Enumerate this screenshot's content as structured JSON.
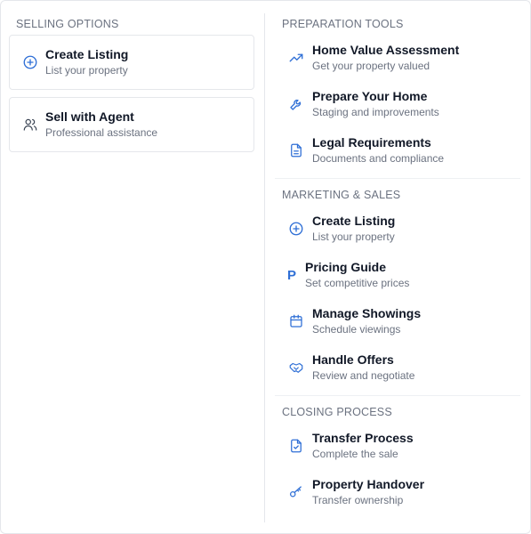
{
  "selling_options": {
    "header": "SELLING OPTIONS",
    "items": [
      {
        "title": "Create Listing",
        "subtitle": "List your property",
        "icon": "plus-circle-icon"
      },
      {
        "title": "Sell with Agent",
        "subtitle": "Professional assistance",
        "icon": "users-icon"
      }
    ]
  },
  "sections": [
    {
      "header": "PREPARATION TOOLS",
      "items": [
        {
          "title": "Home Value Assessment",
          "subtitle": "Get your property valued",
          "icon": "trending-up-icon"
        },
        {
          "title": "Prepare Your Home",
          "subtitle": "Staging and improvements",
          "icon": "wrench-icon"
        },
        {
          "title": "Legal Requirements",
          "subtitle": "Documents and compliance",
          "icon": "document-icon"
        }
      ]
    },
    {
      "header": "MARKETING & SALES",
      "items": [
        {
          "title": "Create Listing",
          "subtitle": "List your property",
          "icon": "plus-circle-icon"
        },
        {
          "title": "Pricing Guide",
          "subtitle": "Set competitive prices",
          "icon": "p-letter-icon",
          "glyph": "P"
        },
        {
          "title": "Manage Showings",
          "subtitle": "Schedule viewings",
          "icon": "calendar-icon"
        },
        {
          "title": "Handle Offers",
          "subtitle": "Review and negotiate",
          "icon": "handshake-icon"
        }
      ]
    },
    {
      "header": "CLOSING PROCESS",
      "items": [
        {
          "title": "Transfer Process",
          "subtitle": "Complete the sale",
          "icon": "file-check-icon"
        },
        {
          "title": "Property Handover",
          "subtitle": "Transfer ownership",
          "icon": "key-icon"
        }
      ]
    }
  ],
  "colors": {
    "accent": "#2f6fd6",
    "muted": "#6b7280",
    "border": "#e5e7eb"
  }
}
